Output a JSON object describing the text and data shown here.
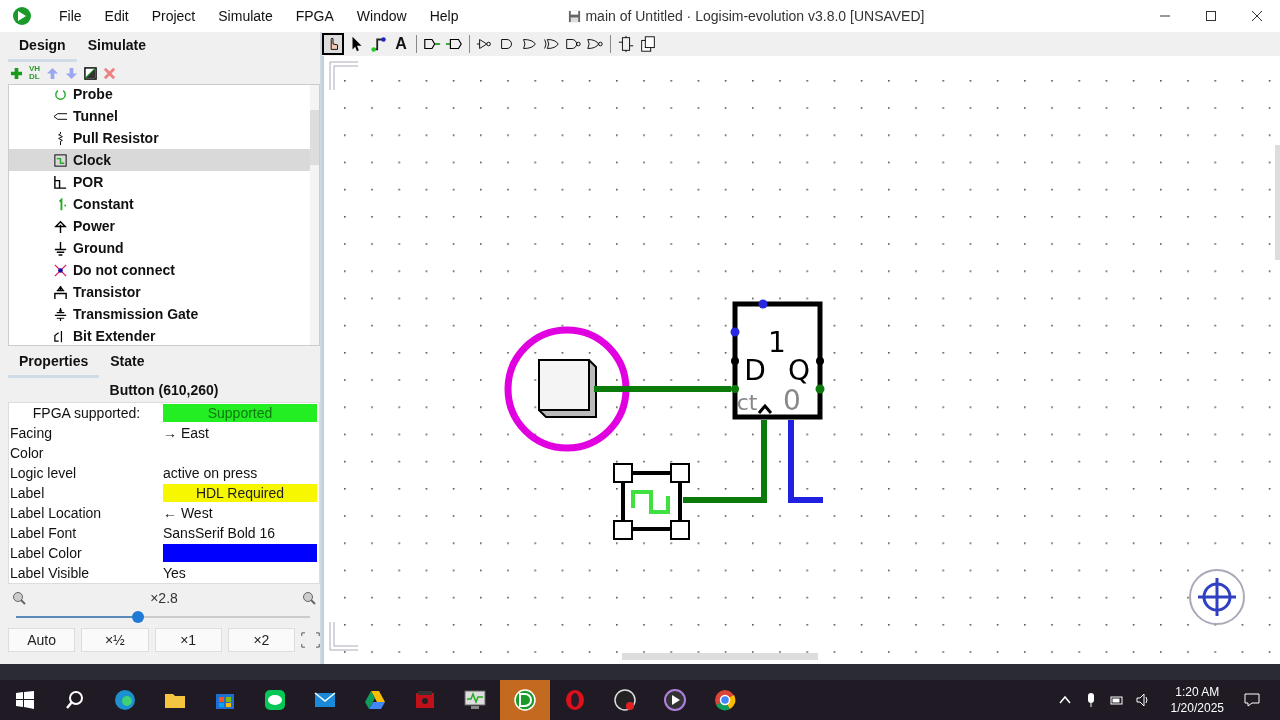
{
  "window": {
    "title": "main of Untitled · Logisim-evolution v3.8.0 [UNSAVED]"
  },
  "menu": [
    "File",
    "Edit",
    "Project",
    "Simulate",
    "FPGA",
    "Window",
    "Help"
  ],
  "explorer_tabs": [
    {
      "label": "Design",
      "selected": true
    },
    {
      "label": "Simulate",
      "selected": false
    }
  ],
  "explorer_toolbar": {
    "vhdl_label": [
      "VH",
      "DL"
    ]
  },
  "components": [
    {
      "label": "Probe",
      "kind": "probe",
      "selected": false
    },
    {
      "label": "Tunnel",
      "kind": "tunnel",
      "selected": false
    },
    {
      "label": "Pull Resistor",
      "kind": "pull",
      "selected": false
    },
    {
      "label": "Clock",
      "kind": "clock",
      "selected": true
    },
    {
      "label": "POR",
      "kind": "por",
      "selected": false
    },
    {
      "label": "Constant",
      "kind": "constant",
      "selected": false
    },
    {
      "label": "Power",
      "kind": "power",
      "selected": false
    },
    {
      "label": "Ground",
      "kind": "ground",
      "selected": false
    },
    {
      "label": "Do not connect",
      "kind": "noconnect",
      "selected": false
    },
    {
      "label": "Transistor",
      "kind": "transistor",
      "selected": false
    },
    {
      "label": "Transmission Gate",
      "kind": "gate",
      "selected": false
    },
    {
      "label": "Bit Extender",
      "kind": "extender",
      "selected": false
    }
  ],
  "property_tabs": [
    {
      "label": "Properties",
      "selected": true
    },
    {
      "label": "State",
      "selected": false
    }
  ],
  "properties": {
    "title": "Button (610,260)",
    "rows": [
      {
        "key": "FPGA supported:",
        "value": "Supported",
        "kind": "ok"
      },
      {
        "key": "Facing",
        "value": "→ East",
        "kind": "plain"
      },
      {
        "key": "Color",
        "kind": "plain"
      },
      {
        "key": "Logic level",
        "value": "active on press",
        "kind": "plain"
      },
      {
        "key": "Label",
        "value": "HDL Required",
        "kind": "warn"
      },
      {
        "key": "Label Location",
        "value": "← West",
        "kind": "plain"
      },
      {
        "key": "Label Font",
        "value": "SansSerif Bold 16",
        "kind": "plain"
      },
      {
        "key": "Label Color",
        "kind": "swatch",
        "color": "#0000ff"
      },
      {
        "key": "Label Visible",
        "value": "Yes",
        "kind": "plain"
      }
    ]
  },
  "zoom": {
    "reading": "×2.8",
    "level": 0.42,
    "buttons": [
      "Auto",
      "×½",
      "×1",
      "×2"
    ]
  },
  "tools": [
    {
      "kind": "poke",
      "selected": true
    },
    {
      "kind": "select",
      "selected": false
    },
    {
      "kind": "wire",
      "selected": false
    },
    {
      "kind": "text",
      "label": "A",
      "selected": false
    },
    {
      "kind": "input",
      "selected": false
    },
    {
      "kind": "output",
      "selected": false
    },
    {
      "kind": "not",
      "selected": false
    },
    {
      "kind": "and",
      "selected": false
    },
    {
      "kind": "or",
      "selected": false
    },
    {
      "kind": "xor",
      "selected": false
    },
    {
      "kind": "nand",
      "selected": false
    },
    {
      "kind": "nor",
      "selected": false
    },
    {
      "kind": "pinout",
      "selected": false
    },
    {
      "kind": "stack",
      "selected": false
    }
  ],
  "circuit": {
    "flipflop": {
      "value": "1",
      "d": "D",
      "q": "Q",
      "ct": "ct",
      "count": "0"
    }
  },
  "taskbar": {
    "apps": [
      {
        "kind": "edge",
        "active": false
      },
      {
        "kind": "folder",
        "active": false
      },
      {
        "kind": "store",
        "active": false
      },
      {
        "kind": "line",
        "active": false
      },
      {
        "kind": "mail",
        "active": false
      },
      {
        "kind": "drive",
        "active": false
      },
      {
        "kind": "film",
        "active": false
      },
      {
        "kind": "monitor",
        "active": false
      },
      {
        "kind": "logisim",
        "active": true
      },
      {
        "kind": "opera",
        "active": false
      },
      {
        "kind": "obs",
        "active": false
      },
      {
        "kind": "player",
        "active": false
      },
      {
        "kind": "chrome",
        "active": false
      }
    ],
    "time": "1:20 AM",
    "date": "1/20/2025"
  }
}
